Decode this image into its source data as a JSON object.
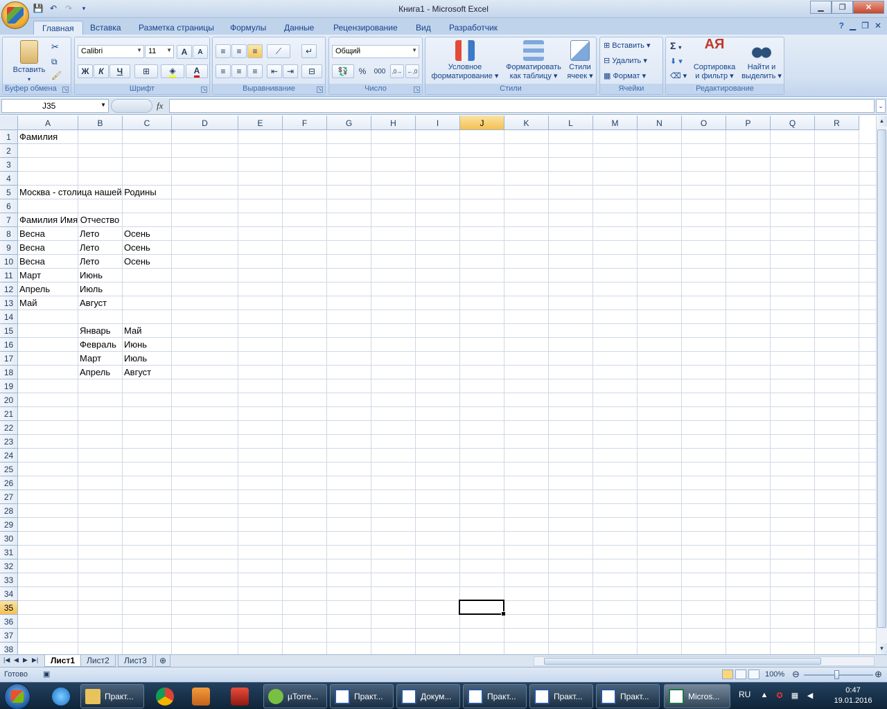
{
  "window": {
    "title": "Книга1 - Microsoft Excel",
    "minimize_icon": "minimize-icon",
    "restore_icon": "restore-icon",
    "close_icon": "close-icon"
  },
  "ribbon_tabs": [
    "Главная",
    "Вставка",
    "Разметка страницы",
    "Формулы",
    "Данные",
    "Рецензирование",
    "Вид",
    "Разработчик"
  ],
  "active_tab": "Главная",
  "groups": {
    "clipboard": {
      "label": "Буфер обмена",
      "paste": "Вставить"
    },
    "font": {
      "label": "Шрифт",
      "font_name": "Calibri",
      "font_size": "11",
      "bold": "Ж",
      "italic": "К",
      "underline": "Ч",
      "grow": "A",
      "shrink": "A"
    },
    "alignment": {
      "label": "Выравнивание"
    },
    "number": {
      "label": "Число",
      "format": "Общий",
      "percent": "%",
      "thousands": "000"
    },
    "styles": {
      "label": "Стили",
      "conditional": "Условное\nформатирование",
      "conditional_l1": "Условное",
      "conditional_l2": "форматирование",
      "table_l1": "Форматировать",
      "table_l2": "как таблицу",
      "cell_l1": "Стили",
      "cell_l2": "ячеек"
    },
    "cells": {
      "label": "Ячейки",
      "insert": "Вставить",
      "delete": "Удалить",
      "format": "Формат"
    },
    "editing": {
      "label": "Редактирование",
      "sigma": "Σ",
      "sort_l1": "Сортировка",
      "sort_l2": "и фильтр",
      "find_l1": "Найти и",
      "find_l2": "выделить"
    }
  },
  "formula_bar": {
    "name_box": "J35",
    "fx": "fx",
    "formula": ""
  },
  "columns": [
    "A",
    "B",
    "C",
    "D",
    "E",
    "F",
    "G",
    "H",
    "I",
    "J",
    "K",
    "L",
    "M",
    "N",
    "O",
    "P",
    "Q",
    "R"
  ],
  "selected_column": "J",
  "row_count": 38,
  "selected_row": 35,
  "cells": [
    {
      "ref": "A1",
      "value": "Фамилия"
    },
    {
      "ref": "A5",
      "value": "Москва - столица нашей Родины"
    },
    {
      "ref": "A7",
      "value": "Фамилия Имя Отчество"
    },
    {
      "ref": "A8",
      "value": "Весна"
    },
    {
      "ref": "B8",
      "value": "Лето"
    },
    {
      "ref": "C8",
      "value": "Осень"
    },
    {
      "ref": "A9",
      "value": "Весна"
    },
    {
      "ref": "B9",
      "value": "Лето"
    },
    {
      "ref": "C9",
      "value": "Осень"
    },
    {
      "ref": "A10",
      "value": "Весна"
    },
    {
      "ref": "B10",
      "value": "Лето"
    },
    {
      "ref": "C10",
      "value": "Осень"
    },
    {
      "ref": "A11",
      "value": "Март"
    },
    {
      "ref": "B11",
      "value": "Июнь"
    },
    {
      "ref": "A12",
      "value": "Апрель"
    },
    {
      "ref": "B12",
      "value": "Июль"
    },
    {
      "ref": "A13",
      "value": "Май"
    },
    {
      "ref": "B13",
      "value": "Август"
    },
    {
      "ref": "B15",
      "value": "Январь"
    },
    {
      "ref": "C15",
      "value": "Май"
    },
    {
      "ref": "B16",
      "value": "Февраль"
    },
    {
      "ref": "C16",
      "value": "Июнь"
    },
    {
      "ref": "B17",
      "value": "Март"
    },
    {
      "ref": "C17",
      "value": "Июль"
    },
    {
      "ref": "B18",
      "value": "Апрель"
    },
    {
      "ref": "C18",
      "value": "Август"
    }
  ],
  "sheets": [
    "Лист1",
    "Лист2",
    "Лист3"
  ],
  "active_sheet": "Лист1",
  "status": {
    "text": "Готово",
    "zoom": "100%"
  },
  "taskbar": {
    "tasks": [
      "Практ...",
      "µTorre...",
      "Практ...",
      "Докум...",
      "Практ...",
      "Практ...",
      "Практ...",
      "Micros..."
    ],
    "lang": "RU",
    "time": "0:47",
    "date": "19.01.2016"
  }
}
